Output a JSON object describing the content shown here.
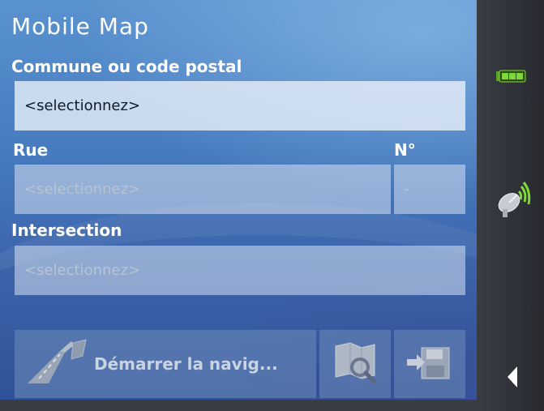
{
  "app": {
    "title": "Mobile Map"
  },
  "form": {
    "city_label": "Commune ou code postal",
    "city_value": "<selectionnez>",
    "street_label": "Rue",
    "number_label": "N°",
    "street_placeholder": "<selectionnez>",
    "number_placeholder": "-",
    "intersection_label": "Intersection",
    "intersection_placeholder": "<selectionnez>"
  },
  "actions": {
    "start_nav_label": "Démarrer la navig...",
    "map_search_icon": "map-search-icon",
    "save_icon": "save-to-favorites-icon"
  },
  "sidebar": {
    "battery_icon": "battery-icon",
    "gps_icon": "gps-satellite-dish-icon",
    "back_icon": "back-arrow-icon"
  },
  "colors": {
    "background_top": "#5a92cf",
    "background_bottom": "#2f5096",
    "sidebar": "#2f3238",
    "battery": "#7fd83a",
    "gps_signal": "#7fd83a"
  }
}
